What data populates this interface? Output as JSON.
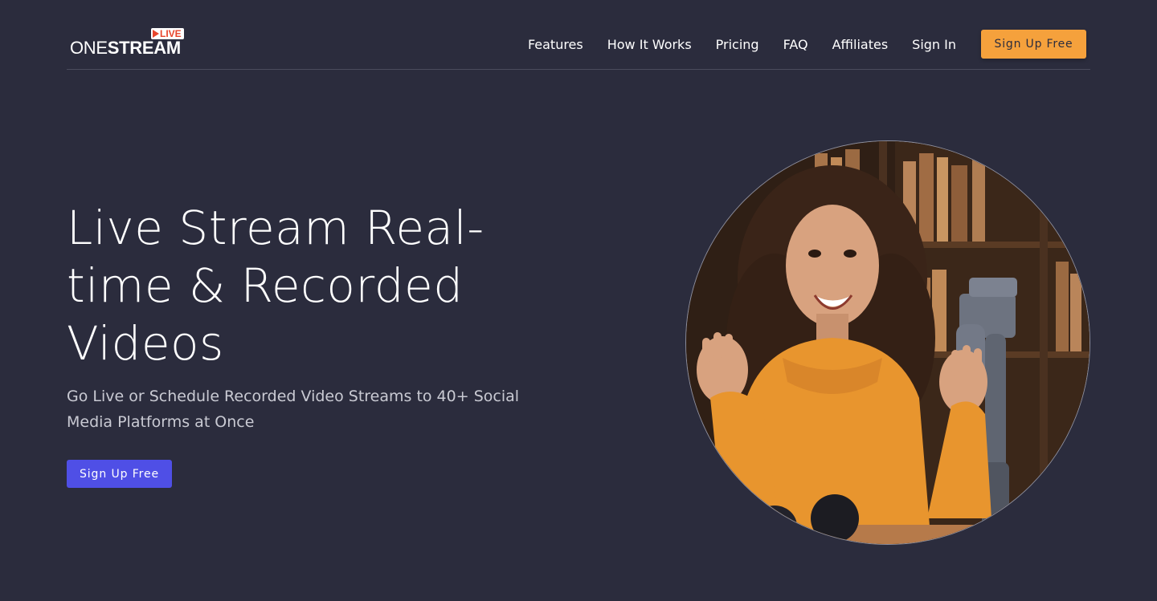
{
  "brand": {
    "logo_word_thin": "ONE",
    "logo_word_bold": "STREAM",
    "logo_badge": "LIVE",
    "badge_color": "#e8452c"
  },
  "nav": {
    "links": [
      "Features",
      "How It Works",
      "Pricing",
      "FAQ",
      "Affiliates",
      "Sign In"
    ],
    "cta_label": "Sign Up Free",
    "cta_color": "#f5a13c"
  },
  "hero": {
    "title": "Live Stream Real-time & Recorded Videos",
    "subtitle": "Go Live or Schedule Recorded Video Streams to 40+ Social Media Platforms at Once",
    "cta_label": "Sign Up Free",
    "cta_color": "#4f4fe6"
  },
  "theme": {
    "background": "#2b2c3d"
  }
}
